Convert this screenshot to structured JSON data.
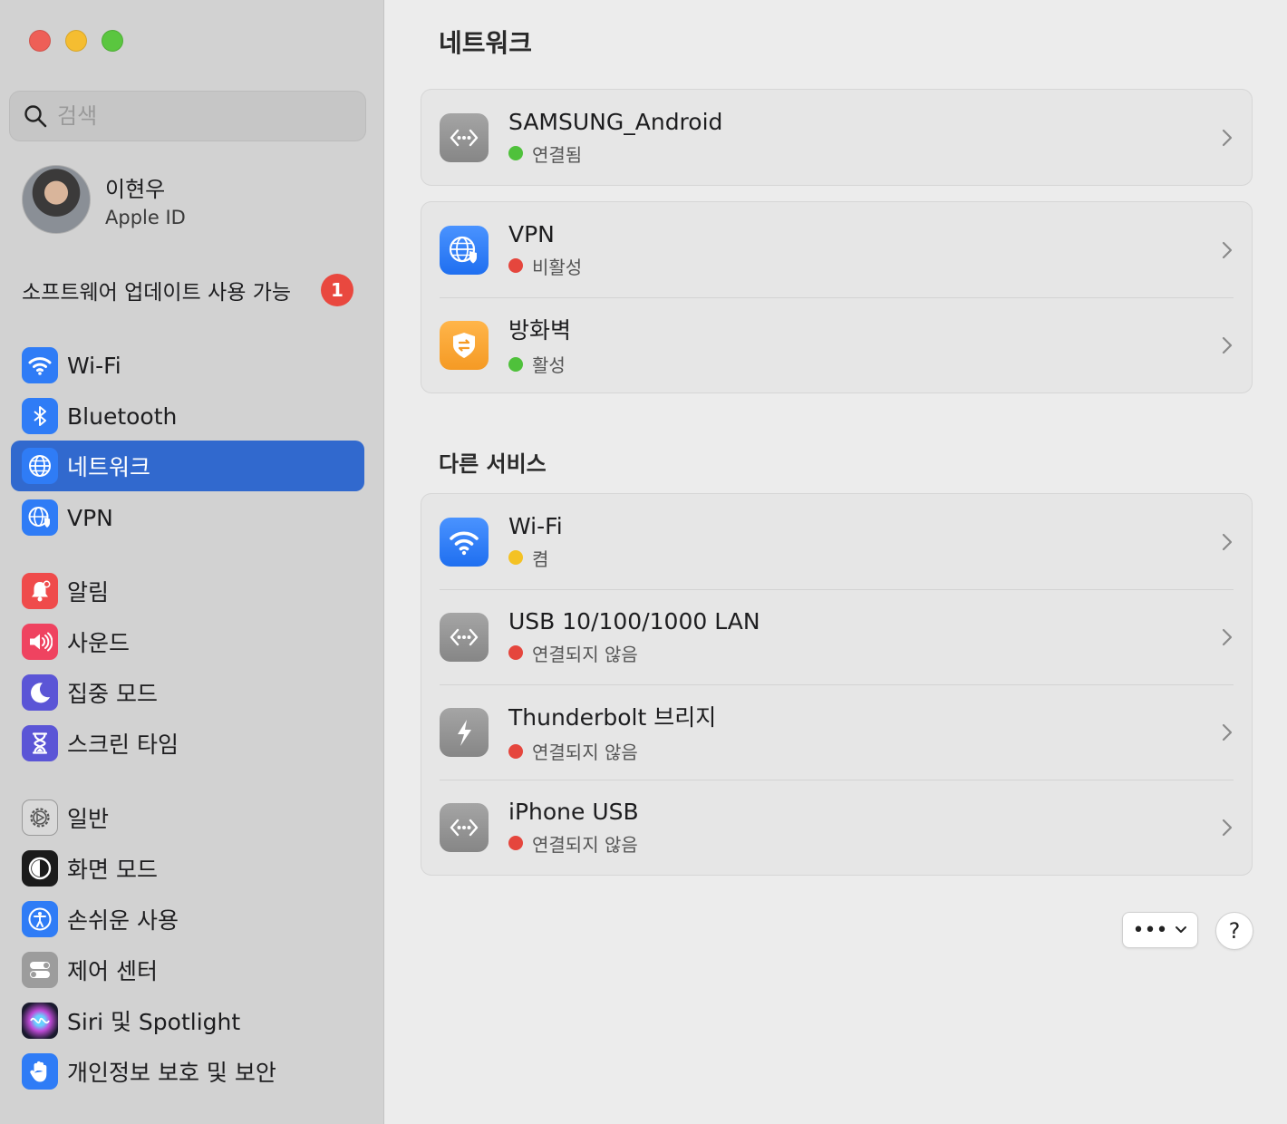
{
  "window": {
    "traffic_lights": [
      "close",
      "minimize",
      "zoom"
    ],
    "colors": {
      "close": "#ee5f57",
      "minimize": "#f5bd31",
      "zoom": "#5ac63f"
    }
  },
  "sidebar": {
    "search": {
      "placeholder": "검색",
      "icon": "search-icon"
    },
    "profile": {
      "name": "이현우",
      "subtitle": "Apple ID"
    },
    "update": {
      "label": "소프트웨어 업데이트 사용 가능",
      "badge": "1"
    },
    "items": [
      {
        "id": "wifi",
        "label": "Wi-Fi",
        "icon": "wifi-icon",
        "color": "#2f7cf6"
      },
      {
        "id": "bluetooth",
        "label": "Bluetooth",
        "icon": "bluetooth-icon",
        "color": "#2f7cf6"
      },
      {
        "id": "network",
        "label": "네트워크",
        "icon": "globe-icon",
        "color": "#2f7cf6",
        "active": true
      },
      {
        "id": "vpn",
        "label": "VPN",
        "icon": "vpn-globe-icon",
        "color": "#2f7cf6"
      },
      {
        "id": "notifications",
        "label": "알림",
        "icon": "bell-icon",
        "color": "#ef4b4b"
      },
      {
        "id": "sound",
        "label": "사운드",
        "icon": "speaker-icon",
        "color": "#ef4360"
      },
      {
        "id": "focus",
        "label": "집중 모드",
        "icon": "moon-icon",
        "color": "#5b55d6"
      },
      {
        "id": "screentime",
        "label": "스크린 타임",
        "icon": "hourglass-icon",
        "color": "#5b55d6"
      },
      {
        "id": "general",
        "label": "일반",
        "icon": "gear-icon",
        "color": "#9a9a9a"
      },
      {
        "id": "appearance",
        "label": "화면 모드",
        "icon": "appearance-icon",
        "color": "#1b1b1b"
      },
      {
        "id": "accessibility",
        "label": "손쉬운 사용",
        "icon": "accessibility-icon",
        "color": "#2f7cf6"
      },
      {
        "id": "controlcenter",
        "label": "제어 센터",
        "icon": "toggles-icon",
        "color": "#9a9a9a"
      },
      {
        "id": "siri",
        "label": "Siri 및 Spotlight",
        "icon": "siri-icon",
        "color": "#2a2a2a"
      },
      {
        "id": "privacy",
        "label": "개인정보 보호 및 보안",
        "icon": "hand-icon",
        "color": "#2f7cf6"
      }
    ]
  },
  "main": {
    "title": "네트워크",
    "groups": [
      {
        "rows": [
          {
            "title": "SAMSUNG_Android",
            "status": "연결됨",
            "status_color": "#4fc13b",
            "icon": "ethernet-dots-icon"
          }
        ]
      },
      {
        "rows": [
          {
            "title": "VPN",
            "status": "비활성",
            "status_color": "#e5463d",
            "icon": "vpn-globe-icon"
          },
          {
            "title": "방화벽",
            "status": "활성",
            "status_color": "#4fc13b",
            "icon": "firewall-shield-icon"
          }
        ]
      }
    ],
    "other_section_title": "다른 서비스",
    "other_services": [
      {
        "title": "Wi-Fi",
        "status": "켬",
        "status_color": "#f4c224",
        "icon": "wifi-icon"
      },
      {
        "title": "USB 10/100/1000 LAN",
        "status": "연결되지 않음",
        "status_color": "#e5463d",
        "icon": "ethernet-dots-icon"
      },
      {
        "title": "Thunderbolt 브리지",
        "status": "연결되지 않음",
        "status_color": "#e5463d",
        "icon": "thunderbolt-icon"
      },
      {
        "title": "iPhone USB",
        "status": "연결되지 않음",
        "status_color": "#e5463d",
        "icon": "ethernet-dots-icon"
      }
    ],
    "buttons": {
      "more": "•••",
      "help": "?"
    }
  }
}
